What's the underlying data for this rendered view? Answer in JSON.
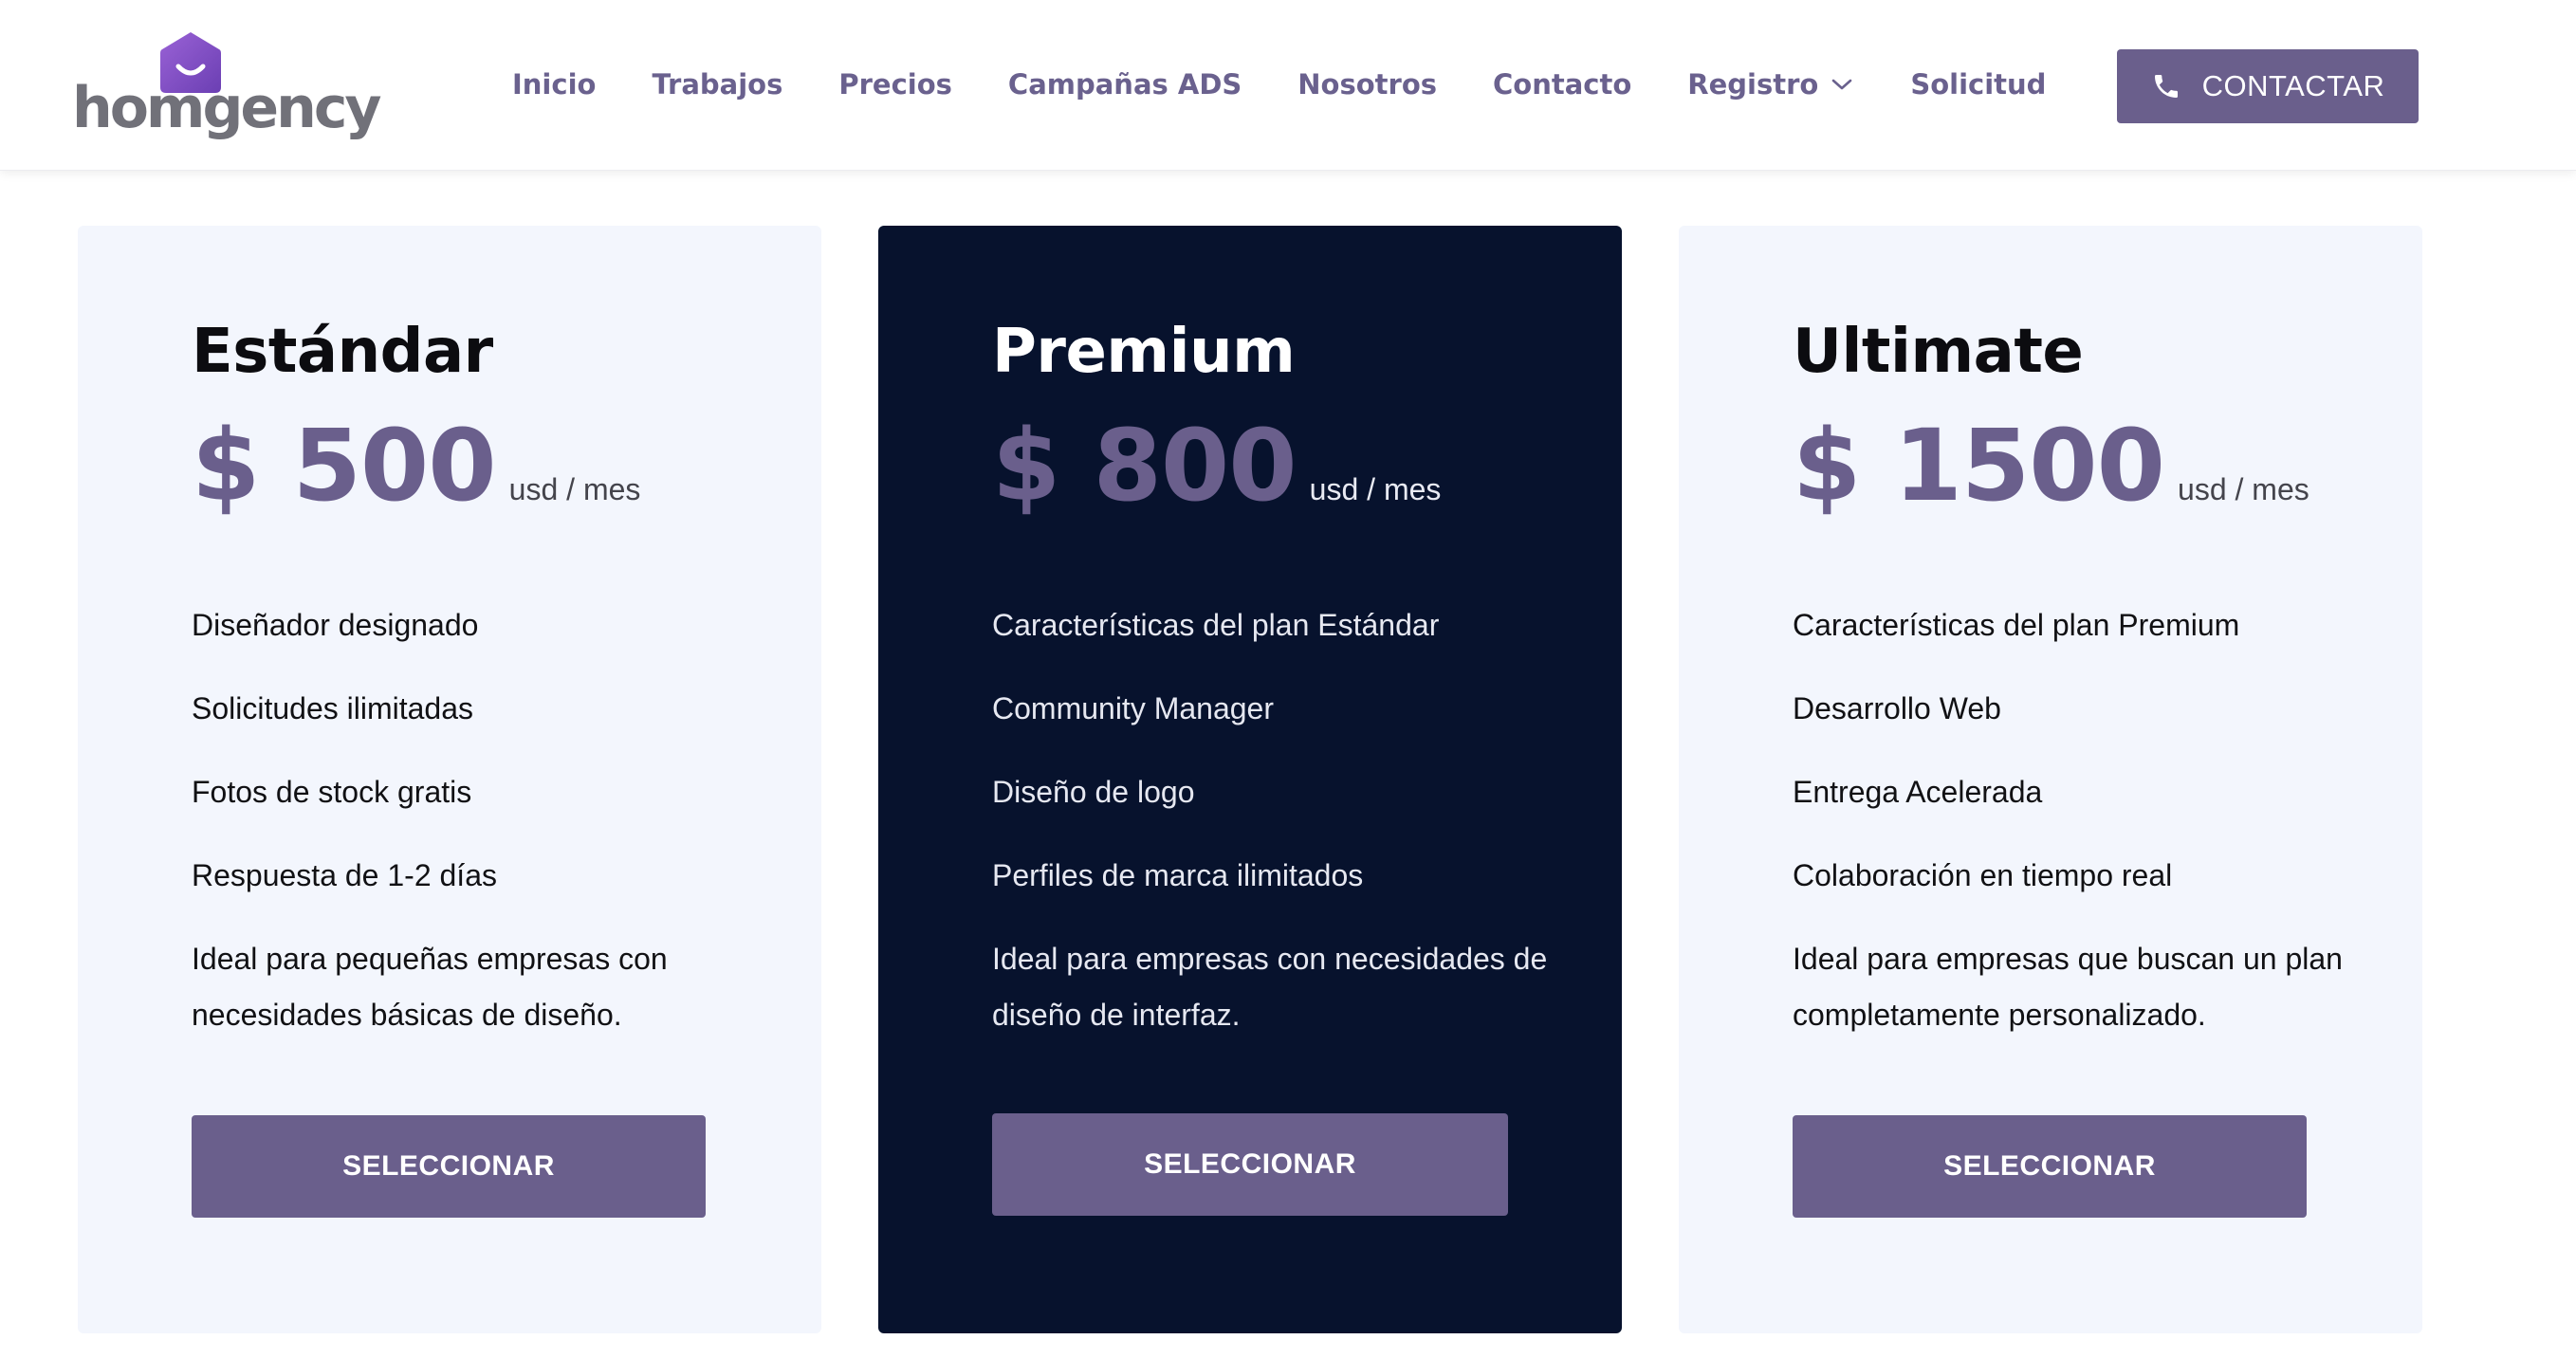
{
  "brand": {
    "name": "homgency"
  },
  "nav": {
    "items": [
      {
        "label": "Inicio"
      },
      {
        "label": "Trabajos"
      },
      {
        "label": "Precios"
      },
      {
        "label": "Campañas ADS"
      },
      {
        "label": "Nosotros"
      },
      {
        "label": "Contacto"
      },
      {
        "label": "Registro",
        "has_dropdown": true
      },
      {
        "label": "Solicitud"
      }
    ],
    "cta_label": "CONTACTAR",
    "cta_icon": "phone-icon"
  },
  "colors": {
    "accent": "#6a5f8c",
    "nav_text": "#6a618e",
    "card_light_bg": "#f3f6fd",
    "card_dark_bg": "#07122d",
    "logo_mark": "#7f4fc0"
  },
  "plans": [
    {
      "name": "Estándar",
      "price": "$ 500",
      "unit": "usd / mes",
      "features": [
        "Diseñador designado",
        "Solicitudes ilimitadas",
        "Fotos de stock gratis",
        "Respuesta de 1-2 días",
        "Ideal para pequeñas empresas con necesidades básicas de diseño."
      ],
      "button_label": "SELECCIONAR"
    },
    {
      "name": "Premium",
      "price": "$ 800",
      "unit": "usd / mes",
      "features": [
        "Características del plan Estándar",
        "Community Manager",
        "Diseño de logo",
        "Perfiles de marca ilimitados",
        "Ideal para empresas con necesidades de diseño de interfaz."
      ],
      "button_label": "SELECCIONAR"
    },
    {
      "name": "Ultimate",
      "price": "$ 1500",
      "unit": "usd / mes",
      "features": [
        "Características del plan Premium",
        "Desarrollo Web",
        "Entrega Acelerada",
        "Colaboración en tiempo real",
        "Ideal para empresas que buscan un plan completamente personalizado."
      ],
      "button_label": "SELECCIONAR"
    }
  ]
}
